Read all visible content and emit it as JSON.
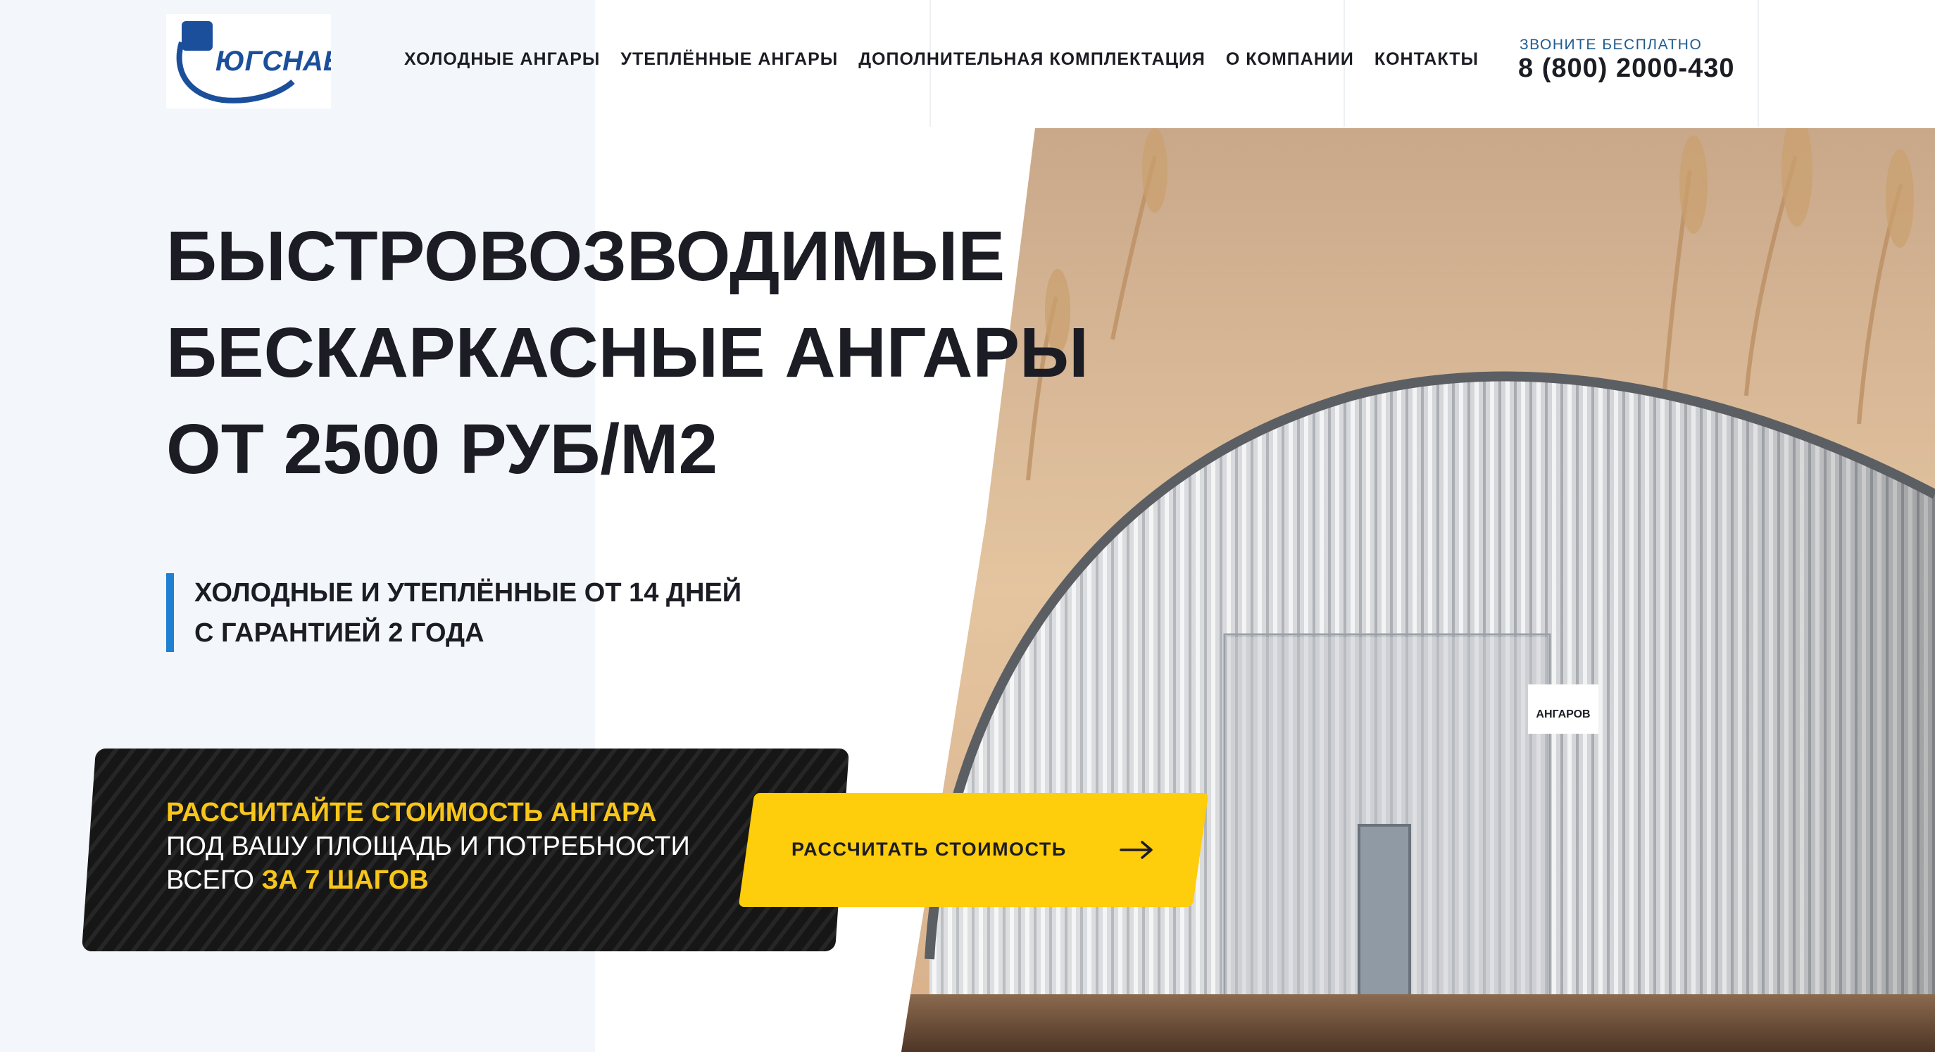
{
  "brand": {
    "logo_text": "ЮГСНАБ",
    "colors": {
      "logo_blue": "#1b4f9c",
      "accent_blue": "#1f7fd0",
      "accent_yellow": "#fecd0b",
      "text_dark": "#1c1c24"
    }
  },
  "nav": {
    "items": [
      {
        "label": "ХОЛОДНЫЕ АНГАРЫ"
      },
      {
        "label": "УТЕПЛЁННЫЕ АНГАРЫ"
      },
      {
        "label": "ДОПОЛНИТЕЛЬНАЯ КОМПЛЕКТАЦИЯ"
      },
      {
        "label": "О КОМПАНИИ"
      },
      {
        "label": "КОНТАКТЫ"
      }
    ]
  },
  "contact": {
    "label": "ЗВОНИТЕ БЕСПЛАТНО",
    "phone": "8 (800) 2000-430"
  },
  "hero": {
    "headline": [
      "БЫСТРОВОЗВОДИМЫЕ",
      "БЕСКАРКАСНЫЕ АНГАРЫ",
      "ОТ 2500 РУБ/М2"
    ],
    "sub": [
      "ХОЛОДНЫЕ И УТЕПЛЁННЫЕ ОТ 14 ДНЕЙ",
      "С ГАРАНТИЕЙ 2 ГОДА"
    ],
    "sign": {
      "title": "АНГАРОВ"
    }
  },
  "cta": {
    "line1": "РАССЧИТАЙТЕ СТОИМОСТЬ АНГАРА",
    "line2": "ПОД ВАШУ ПЛОЩАДЬ И ПОТРЕБНОСТИ",
    "line3_prefix": "ВСЕГО ",
    "line3_highlight": "ЗА 7 ШАГОВ",
    "button_label": "РАССЧИТАТЬ СТОИМОСТЬ",
    "button_icon": "arrow-right-icon"
  }
}
